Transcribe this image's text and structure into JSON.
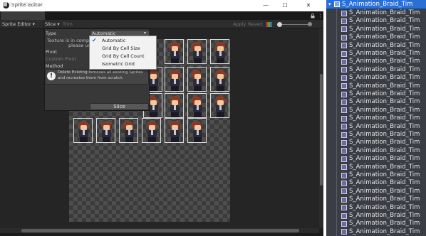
{
  "window": {
    "title": "Sprite Editor",
    "minimize": "—",
    "maximize": "☐",
    "close": "✕"
  },
  "tab": {
    "label": "Sprite Editor",
    "lock_glyph": "🔒",
    "menu_glyph": "⋮"
  },
  "toolbar": {
    "mode": "Sprite Editor",
    "mode_arrow": "▾",
    "slice": "Slice",
    "slice_arrow": "▾",
    "trim": "Trim",
    "apply": "Apply",
    "revert": "Revert",
    "zoom_level": 0.05
  },
  "slice_panel": {
    "type_label": "Type",
    "type_value": "Automatic",
    "compressed_note_line1": "Texture is in compress",
    "compressed_note_line2": "please us",
    "pivot_label": "Pivot",
    "custom_pivot_label": "Custom Pivot",
    "method_label": "Method",
    "help_text": "Delete Existing removes all existing Sprites and recreates them from scratch.",
    "slice_button": "Slice"
  },
  "type_dropdown": {
    "options": [
      "Automatic",
      "Grid By Cell Size",
      "Grid By Cell Count",
      "Isometric Grid"
    ],
    "selected": "Automatic",
    "check": "✔"
  },
  "hierarchy": {
    "root": "S_Animation_Braid_Tim",
    "root_arrow": "▾",
    "child": "S_Animation_Braid_Tim",
    "child_count": 28
  },
  "colors": {
    "accent": "#2a6fd4",
    "editor_bg": "#1e1e1e",
    "panel_bg": "#383838",
    "hierarchy_bg": "#3b3d44"
  },
  "icons": [
    "unity-logo-icon",
    "sprite-editor-tab-icon",
    "lock-icon",
    "kebab-menu-icon",
    "rgb-channel-icon",
    "alpha-channel-icon",
    "zoom-slider-icon",
    "info-icon",
    "checkmark-icon",
    "expand-arrow-icon",
    "game-object-icon"
  ]
}
